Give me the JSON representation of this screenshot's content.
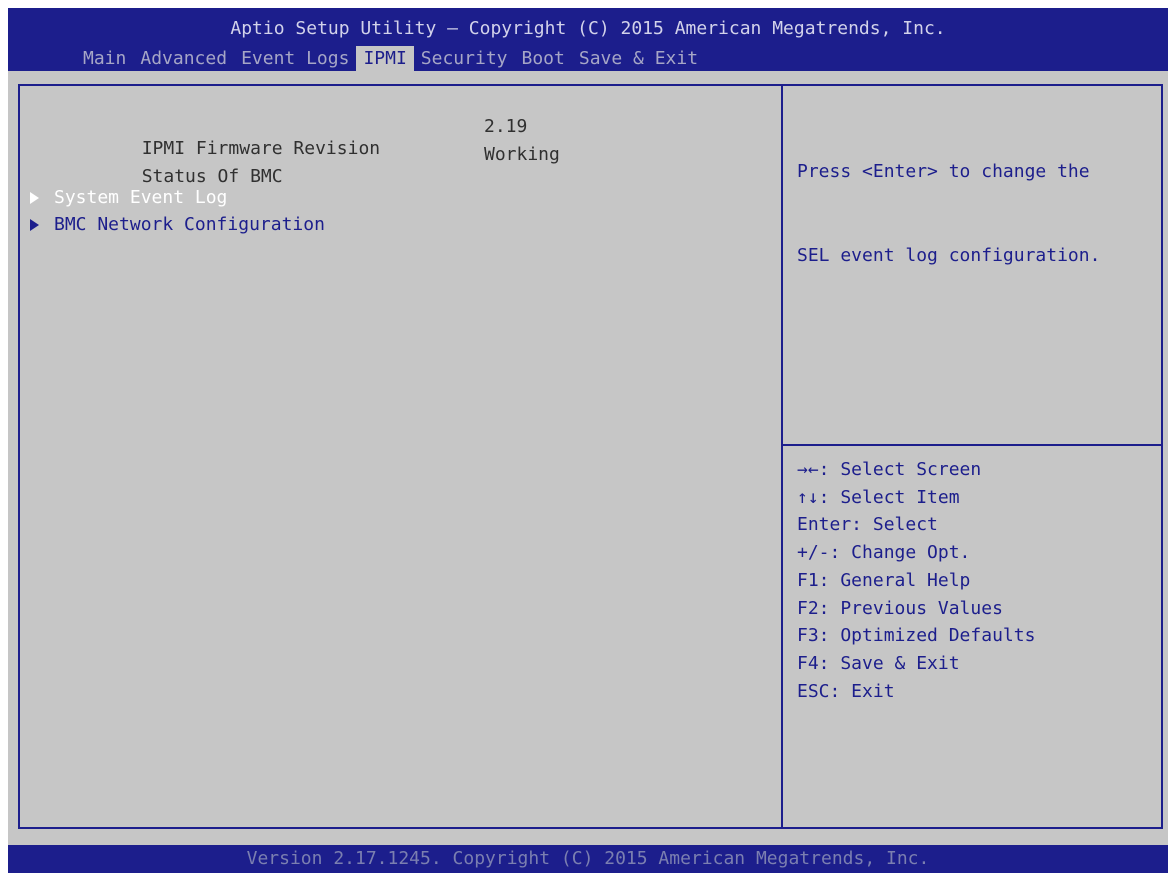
{
  "header": {
    "title": "Aptio Setup Utility – Copyright (C) 2015 American Megatrends, Inc.",
    "tabs": [
      {
        "label": "Main",
        "active": false
      },
      {
        "label": "Advanced",
        "active": false
      },
      {
        "label": "Event Logs",
        "active": false
      },
      {
        "label": "IPMI",
        "active": true
      },
      {
        "label": "Security",
        "active": false
      },
      {
        "label": "Boot",
        "active": false
      },
      {
        "label": "Save & Exit",
        "active": false
      }
    ]
  },
  "main": {
    "info": [
      {
        "label": "IPMI Firmware Revision",
        "value": "2.19"
      },
      {
        "label": "Status Of BMC",
        "value": "Working"
      }
    ],
    "submenus": [
      {
        "label": "System Event Log",
        "selected": true
      },
      {
        "label": "BMC Network Configuration",
        "selected": false
      }
    ]
  },
  "help": {
    "lines": [
      "Press <Enter> to change the",
      "SEL event log configuration."
    ]
  },
  "keys": [
    "→←: Select Screen",
    "↑↓: Select Item",
    "Enter: Select",
    "+/-: Change Opt.",
    "F1: General Help",
    "F2: Previous Values",
    "F3: Optimized Defaults",
    "F4: Save & Exit",
    "ESC: Exit"
  ],
  "footer": {
    "text": "Version 2.17.1245. Copyright (C) 2015 American Megatrends, Inc."
  },
  "colors": {
    "bios_blue": "#1c1e8c",
    "bios_gray": "#c6c6c6",
    "selected_text": "#ffffff"
  }
}
